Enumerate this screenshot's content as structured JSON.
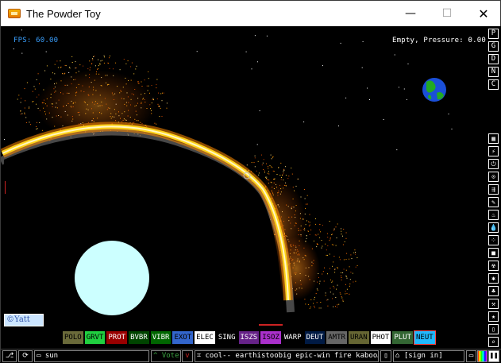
{
  "window": {
    "title": "The Powder Toy",
    "minimize": "—",
    "maximize": "☐",
    "close": "✕"
  },
  "hud": {
    "fps": "FPS: 60.00",
    "status": "Empty, Pressure: 0.00"
  },
  "canvas": {
    "signature": "©Yatt"
  },
  "right_buttons": [
    {
      "name": "P",
      "label": "P"
    },
    {
      "name": "G",
      "label": "G"
    },
    {
      "name": "D",
      "label": "D"
    },
    {
      "name": "N",
      "label": "N"
    },
    {
      "name": "C",
      "label": "C"
    }
  ],
  "category_icons": [
    "walls-icon",
    "electronics-icon",
    "powered-icon",
    "sensors-icon",
    "force-icon",
    "explosives-icon",
    "gases-icon",
    "liquids-icon",
    "powders-icon",
    "solids-icon",
    "radioactive-icon",
    "special-icon",
    "life-icon",
    "tools-icon",
    "favorites-icon",
    "decoration-icon",
    "search-icon"
  ],
  "elements": [
    {
      "label": "POLO",
      "bg": "#6a6a3a",
      "fg": "#000000"
    },
    {
      "label": "GRVT",
      "bg": "#20d040",
      "fg": "#000000"
    },
    {
      "label": "PROT",
      "bg": "#990000",
      "fg": "#ffffff"
    },
    {
      "label": "BVBR",
      "bg": "#004400",
      "fg": "#ffffff"
    },
    {
      "label": "VIBR",
      "bg": "#006600",
      "fg": "#ffffff"
    },
    {
      "label": "EXOT",
      "bg": "#3366cc",
      "fg": "#000000"
    },
    {
      "label": "ELEC",
      "bg": "#ffffff",
      "fg": "#000000"
    },
    {
      "label": "SING",
      "bg": "#000000",
      "fg": "#ffffff"
    },
    {
      "label": "ISZS",
      "bg": "#662288",
      "fg": "#ffffff"
    },
    {
      "label": "ISOZ",
      "bg": "#aa30cc",
      "fg": "#000000"
    },
    {
      "label": "WARP",
      "bg": "#000000",
      "fg": "#ffffff"
    },
    {
      "label": "DEUT",
      "bg": "#001a44",
      "fg": "#ffffff"
    },
    {
      "label": "AMTR",
      "bg": "#666666",
      "fg": "#000000"
    },
    {
      "label": "URAN",
      "bg": "#666633",
      "fg": "#000000"
    },
    {
      "label": "PHOT",
      "bg": "#ffffff",
      "fg": "#000000"
    },
    {
      "label": "PLUT",
      "bg": "#336633",
      "fg": "#ffffff"
    },
    {
      "label": "NEUT",
      "bg": "#20b8ff",
      "fg": "#000000"
    }
  ],
  "bottom": {
    "save_name": "sun",
    "vote": "Vote",
    "tags": "cool-- earthistoobig epic-win fire kaboo…",
    "sign_in": "[sign in]"
  },
  "colors": {
    "fps": "#3aa0ff",
    "sun_yellow": "#ffd21a",
    "moon": "#ccffff"
  }
}
